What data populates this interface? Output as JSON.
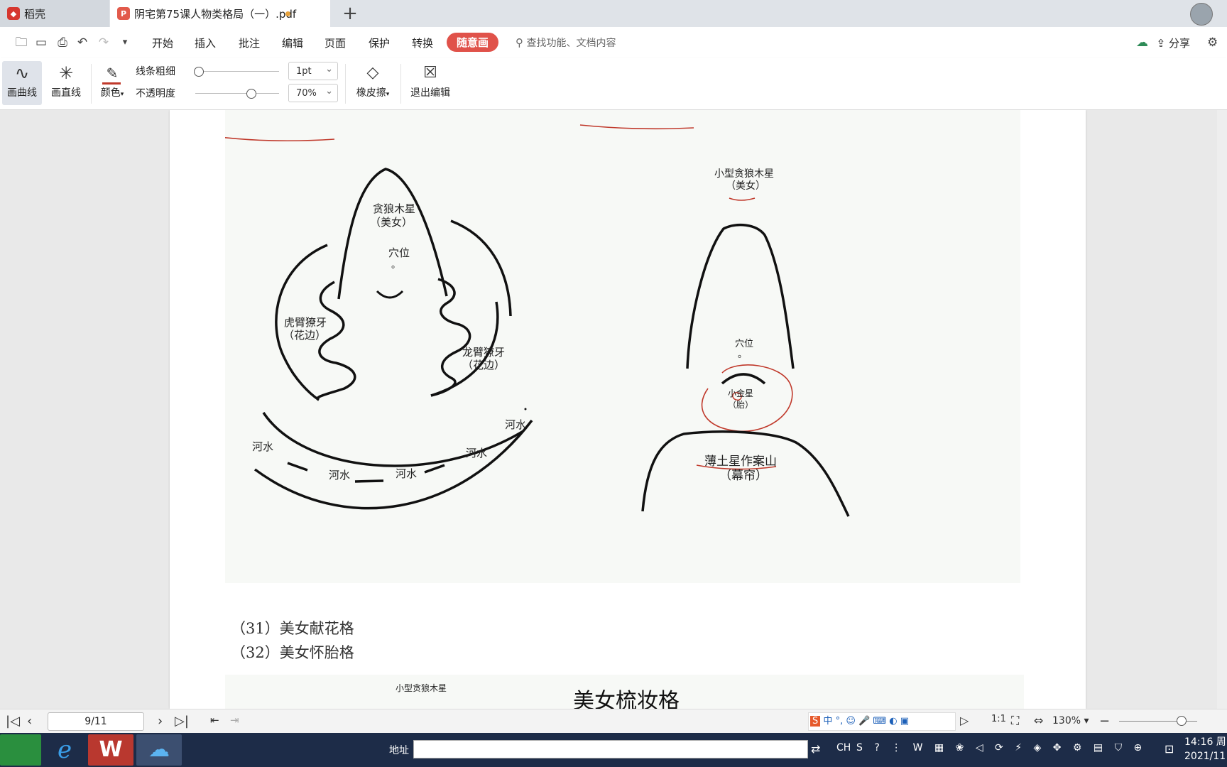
{
  "tabs": {
    "home_label": "稻壳",
    "doc_label": "阴宅第75课人物类格局（一）.pdf"
  },
  "menu": {
    "items": [
      "开始",
      "插入",
      "批注",
      "编辑",
      "页面",
      "保护",
      "转换",
      "随意画"
    ],
    "search_placeholder": "查找功能、文档内容",
    "share_label": "分享"
  },
  "pen_toolbar": {
    "curve_label": "画曲线",
    "line_label": "画直线",
    "color_label": "颜色",
    "thickness_label": "线条粗细",
    "opacity_label": "不透明度",
    "thickness_value": "1pt",
    "opacity_value": "70%",
    "thickness_level": 0,
    "opacity_level": 0.7,
    "eraser_label": "橡皮擦",
    "exit_label": "退出编辑",
    "pen_color": "#c0392b"
  },
  "diagram_left": {
    "peak_title": "贪狼木星",
    "peak_sub": "（美女）",
    "point_label": "穴位",
    "point_mark": "。",
    "tiger_arm": "虎臂獠牙",
    "tiger_sub": "（花边）",
    "dragon_arm": "龙臂獠牙",
    "dragon_sub": "（花边）",
    "river_labels": [
      "河水",
      "河水",
      "河水",
      "河水",
      "河水"
    ]
  },
  "diagram_right": {
    "peak_title": "小型贪狼木星",
    "peak_sub": "（美女）",
    "point_label": "穴位",
    "point_mark": "。",
    "gold_star": "小金星",
    "gold_sub": "（胎）",
    "table_mountain": "薄土星作案山",
    "table_sub": "（幕帘）"
  },
  "captions": [
    "（31）美女献花格",
    "（32）美女怀胎格"
  ],
  "next_figure": {
    "small_label": "小型贪狼木星",
    "heading": "美女梳妆格"
  },
  "status": {
    "page_indicator": "9/11",
    "zoom": "130%",
    "ime_label": "中"
  },
  "taskbar": {
    "address_label": "地址",
    "lang": "CH",
    "time": "14:16 周",
    "date": "2021/11"
  }
}
